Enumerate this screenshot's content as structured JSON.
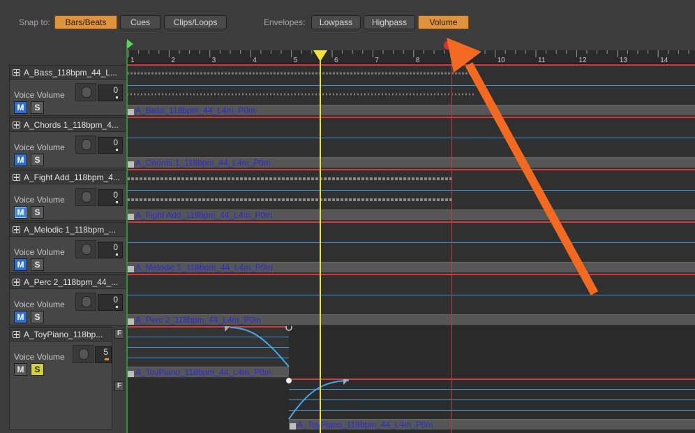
{
  "toolbar": {
    "snap_label": "Snap to:",
    "snap_options": [
      "Bars/Beats",
      "Cues",
      "Clips/Loops"
    ],
    "snap_selected": "Bars/Beats",
    "envelopes_label": "Envelopes:",
    "envelope_options": [
      "Lowpass",
      "Highpass",
      "Volume"
    ],
    "envelope_selected": "Volume"
  },
  "ruler": {
    "bars": [
      "1",
      "2",
      "3",
      "4",
      "5",
      "6",
      "7",
      "8",
      "9",
      "10",
      "11",
      "12",
      "13",
      "14"
    ]
  },
  "tracks": [
    {
      "name": "A_Bass_118bpm_44_L...",
      "volume_label": "Voice Volume",
      "volume": "0",
      "mute": "M",
      "solo": "S",
      "clip": "A_Bass_118bpm_44_L4m_P0m"
    },
    {
      "name": "A_Chords 1_118bpm_4...",
      "volume_label": "Voice Volume",
      "volume": "0",
      "mute": "M",
      "solo": "S",
      "clip": "A_Chords 1_118bpm_44_L4m_P0m"
    },
    {
      "name": "A_Fight Add_118bpm_4...",
      "volume_label": "Voice Volume",
      "volume": "0",
      "mute": "M",
      "solo": "S",
      "clip": "A_Fight Add_118bpm_44_L4m_P0m"
    },
    {
      "name": "A_Melodic 1_118bpm_...",
      "volume_label": "Voice Volume",
      "volume": "0",
      "mute": "M",
      "solo": "S",
      "clip": "A_Melodic 1_118bpm_44_L4m_P0m"
    },
    {
      "name": "A_Perc 2_118bpm_44_...",
      "volume_label": "Voice Volume",
      "volume": "0",
      "mute": "M",
      "solo": "S",
      "clip": "A_Perc 2_118bpm_44_L4m_P0m"
    },
    {
      "name": "A_ToyPiano_118bp...",
      "volume_label": "Voice Volume",
      "volume": "5",
      "mute": "M",
      "solo": "S",
      "clip": "A_ToyPiano_118bpm_44_L4m_P0m",
      "clip2": "A_ToyPiano_118bpm_44_L4m_P0m"
    }
  ],
  "fade_button_label": "F",
  "colors": {
    "accent": "#e0933f",
    "mute_on": "#2f6fd0",
    "solo_on": "#d6cf3c",
    "envelope": "#3d95d6",
    "playhead": "#e8e04a",
    "annotation_arrow": "#f26a21"
  }
}
